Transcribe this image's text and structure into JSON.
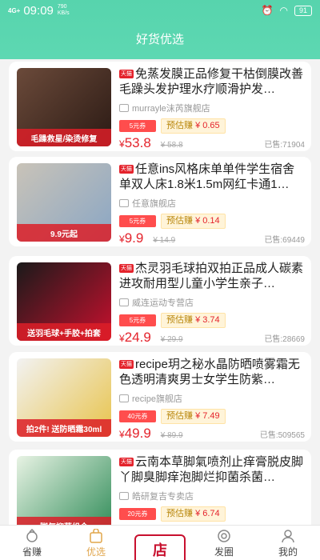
{
  "status_bar": {
    "signal": "4G+",
    "time": "09:09",
    "speed": "790",
    "speed_unit": "KB/s",
    "battery": "91"
  },
  "header": {
    "title": "好货优选"
  },
  "products": [
    {
      "tag": "天猫",
      "name": "免蒸发膜正品修复干枯倒膜改善毛躁头发护理水疗顺滑护发…",
      "shop": "murrayle沫芮旗舰店",
      "coupon": "5元券",
      "estimate_label": "预估赚",
      "estimate_value": "¥ 0.65",
      "price_symbol": "¥",
      "price": "53.8",
      "original_price": "¥ 58.8",
      "sold": "已售:71904",
      "thumb_caption": "毛躁救星/染烫修复",
      "colors": [
        "#6b4a3a",
        "#2b1a14"
      ]
    },
    {
      "tag": "天猫",
      "name": "任意ins风格床单单件学生宿舍单双人床1.8米1.5m网红卡通1…",
      "shop": "任意旗舰店",
      "coupon": "5元券",
      "estimate_label": "预估赚",
      "estimate_value": "¥ 0.14",
      "price_symbol": "¥",
      "price": "9.9",
      "original_price": "¥ 14.9",
      "sold": "已售:69449",
      "thumb_caption": "9.9元起",
      "colors": [
        "#c9c3b8",
        "#8aa6c4"
      ]
    },
    {
      "tag": "天猫",
      "name": "杰灵羽毛球拍双拍正品成人碳素进攻耐用型儿童小学生亲子…",
      "shop": "威连运动专营店",
      "coupon": "5元券",
      "estimate_label": "预估赚",
      "estimate_value": "¥ 3.74",
      "price_symbol": "¥",
      "price": "24.9",
      "original_price": "¥ 29.9",
      "sold": "已售:28669",
      "thumb_caption": "送羽毛球+手胶+拍套",
      "colors": [
        "#1a1a1a",
        "#c8102e"
      ]
    },
    {
      "tag": "天猫",
      "name": "recipe玥之秘水晶防晒喷雾霜无色透明清爽男士女学生防紫…",
      "shop": "recipe旗舰店",
      "coupon": "40元券",
      "estimate_label": "预估赚",
      "estimate_value": "¥ 7.49",
      "price_symbol": "¥",
      "price": "49.9",
      "original_price": "¥ 89.9",
      "sold": "已售:509565",
      "thumb_caption": "拍2件! 送防晒霜30ml",
      "colors": [
        "#f2f2f2",
        "#e8c34a"
      ]
    },
    {
      "tag": "天猫",
      "name": "云南本草脚氣喷剂止痒膏脱皮脚丫脚臭脚痒泡脚烂抑菌杀菌…",
      "shop": "皓研复吉专卖店",
      "coupon": "20元券",
      "estimate_label": "预估赚",
      "estimate_value": "¥ 6.74",
      "price_symbol": "¥",
      "price": "",
      "original_price": "",
      "sold": "",
      "thumb_caption": "脚气抑菌组合",
      "colors": [
        "#e8f3e4",
        "#2e8b57"
      ]
    }
  ],
  "tabbar": {
    "items": [
      {
        "label": "省赚",
        "icon": "piggy-icon"
      },
      {
        "label": "优选",
        "icon": "bag-icon"
      },
      {
        "label": "",
        "icon": "center-logo"
      },
      {
        "label": "发圈",
        "icon": "share-circle-icon"
      },
      {
        "label": "我的",
        "icon": "user-icon"
      }
    ],
    "center_logo_text": "店"
  }
}
